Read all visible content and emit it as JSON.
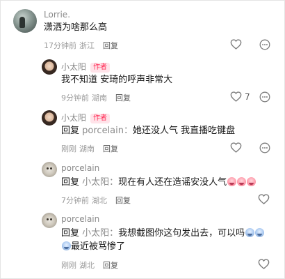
{
  "comments": [
    {
      "user": "Lorrie.",
      "text": "潇洒为啥那么高",
      "time": "17分钟前",
      "location": "浙江",
      "reply_label": "回复"
    },
    {
      "user": "小太阳",
      "author_tag": "作者",
      "text": "我不知道 安琦的呼声非常大",
      "time": "9分钟前",
      "location": "湖南",
      "reply_label": "回复",
      "like_count": "7"
    },
    {
      "user": "小太阳",
      "author_tag": "作者",
      "reply_prefix": "回复",
      "reply_to": "porcelain：",
      "text": "她还没人气 我直播吃键盘",
      "time": "刚刚",
      "location": "湖南",
      "reply_label": "回复"
    },
    {
      "user": "porcelain",
      "reply_prefix": "回复",
      "reply_to": "小太阳：",
      "text": "现在有人还在造谣安没人气",
      "time": "7分钟前",
      "location": "湖北",
      "reply_label": "回复"
    },
    {
      "user": "porcelain",
      "reply_prefix": "回复",
      "reply_to": "小太阳：",
      "text": "我想截图你这句发出去，可以吗",
      "text_line2": "最近被骂惨了",
      "time": "刚刚",
      "location": "湖北",
      "reply_label": "回复"
    }
  ],
  "icons": {
    "like": "heart-outline-icon",
    "more": "more-options-icon"
  },
  "colors": {
    "author_tag": "#ff2c55",
    "author_tag_bg": "#ffe3e9",
    "meta": "#9a9a9a"
  }
}
